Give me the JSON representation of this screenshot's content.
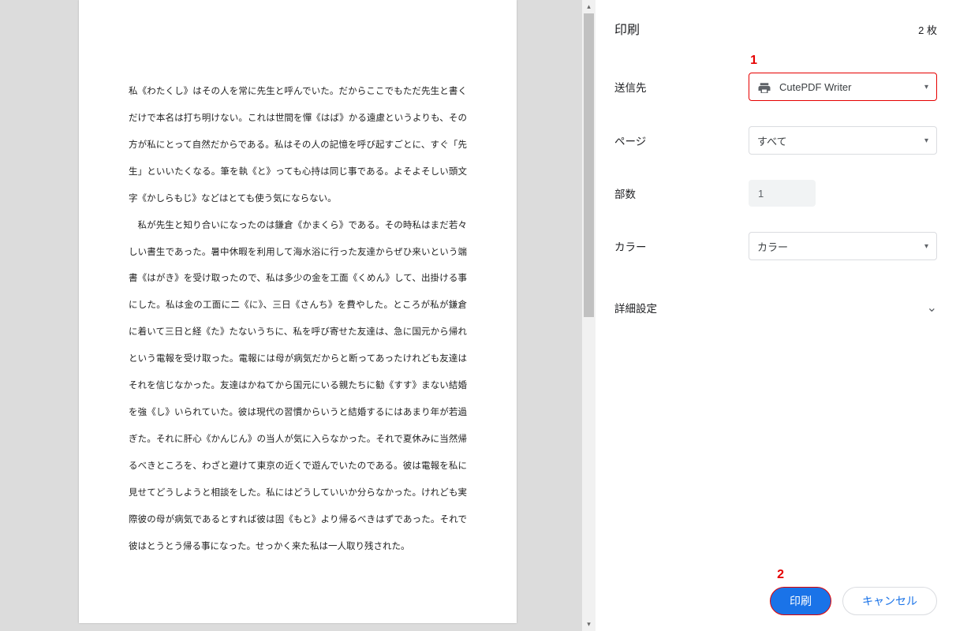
{
  "preview": {
    "paragraph1": "私《わたくし》はその人を常に先生と呼んでいた。だからここでもただ先生と書くだけで本名は打ち明けない。これは世間を憚《はば》かる遠慮というよりも、その方が私にとって自然だからである。私はその人の記憶を呼び起すごとに、すぐ「先生」といいたくなる。筆を執《と》っても心持は同じ事である。よそよそしい頭文字《かしらもじ》などはとても使う気にならない。",
    "paragraph2": "私が先生と知り合いになったのは鎌倉《かまくら》である。その時私はまだ若々しい書生であった。暑中休暇を利用して海水浴に行った友達からぜひ来いという端書《はがき》を受け取ったので、私は多少の金を工面《くめん》して、出掛ける事にした。私は金の工面に二《に》、三日《さんち》を費やした。ところが私が鎌倉に着いて三日と経《た》たないうちに、私を呼び寄せた友達は、急に国元から帰れという電報を受け取った。電報には母が病気だからと断ってあったけれども友達はそれを信じなかった。友達はかねてから国元にいる親たちに勧《すす》まない結婚を強《し》いられていた。彼は現代の習慣からいうと結婚するにはあまり年が若過ぎた。それに肝心《かんじん》の当人が気に入らなかった。それで夏休みに当然帰るべきところを、わざと避けて東京の近くで遊んでいたのである。彼は電報を私に見せてどうしようと相談をした。私にはどうしていいか分らなかった。けれども実際彼の母が病気であるとすれば彼は固《もと》より帰るべきはずであった。それで彼はとうとう帰る事になった。せっかく来た私は一人取り残された。"
  },
  "panel": {
    "title": "印刷",
    "sheet_count": "2 枚",
    "rows": {
      "destination_label": "送信先",
      "destination_value": "CutePDF Writer",
      "pages_label": "ページ",
      "pages_value": "すべて",
      "copies_label": "部数",
      "copies_value": "1",
      "color_label": "カラー",
      "color_value": "カラー"
    },
    "advanced_label": "詳細設定",
    "buttons": {
      "print": "印刷",
      "cancel": "キャンセル"
    }
  },
  "callouts": {
    "one": "1",
    "two": "2"
  }
}
